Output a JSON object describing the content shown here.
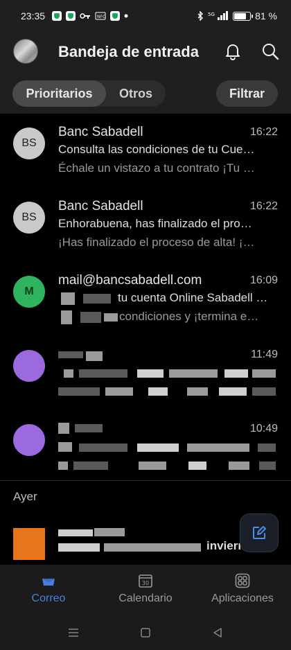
{
  "status_bar": {
    "time": "23:35",
    "network": "5G",
    "battery": "81 %",
    "battery_fraction": 0.81
  },
  "header": {
    "title": "Bandeja de entrada",
    "tabs": [
      {
        "label": "Prioritarios",
        "active": true
      },
      {
        "label": "Otros",
        "active": false
      }
    ],
    "filter_label": "Filtrar"
  },
  "mails": [
    {
      "initials": "BS",
      "sender": "Banc Sabadell",
      "time": "16:22",
      "subject": "Consulta las condiciones de tu Cue…",
      "preview": "Échale un vistazo a tu contrato ¡Tu …"
    },
    {
      "initials": "BS",
      "sender": "Banc Sabadell",
      "time": "16:22",
      "subject": "Enhorabuena, has finalizado el pro…",
      "preview": "¡Has finalizado el proceso de alta! ¡…"
    },
    {
      "initials": "M",
      "sender": "mail@bancsabadell.com",
      "time": "16:09",
      "subject": "tu cuenta Online Sabadell …",
      "preview": "condiciones y ¡termina e…"
    },
    {
      "initials": "",
      "sender": "",
      "time": "11:49",
      "subject": "",
      "preview": ""
    },
    {
      "initials": "",
      "sender": "",
      "time": "10:49",
      "subject": "",
      "preview": ""
    }
  ],
  "section_label": "Ayer",
  "partial_mail": {
    "subject_fragment": "invierno"
  },
  "bottom_nav": [
    {
      "label": "Correo",
      "active": true,
      "icon": "mail-icon"
    },
    {
      "label": "Calendario",
      "active": false,
      "icon": "calendar-icon",
      "day": "30"
    },
    {
      "label": "Aplicaciones",
      "active": false,
      "icon": "apps-icon"
    }
  ],
  "colors": {
    "accent": "#4a7fe0",
    "header_bg": "#1f1f1f",
    "background": "#000000"
  }
}
